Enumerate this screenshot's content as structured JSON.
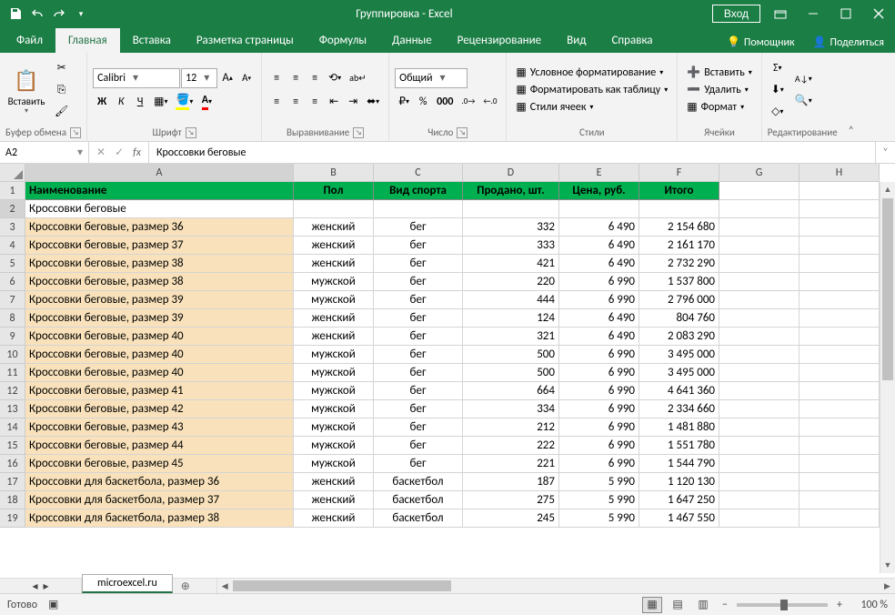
{
  "title": "Группировка - Excel",
  "login_btn": "Вход",
  "tabs": [
    "Файл",
    "Главная",
    "Вставка",
    "Разметка страницы",
    "Формулы",
    "Данные",
    "Рецензирование",
    "Вид",
    "Справка"
  ],
  "tab_active_idx": 1,
  "tell_me": "Помощник",
  "share": "Поделиться",
  "ribbon": {
    "clipboard": {
      "paste": "Вставить",
      "label": "Буфер обмена"
    },
    "font": {
      "name": "Calibri",
      "size": "12",
      "label": "Шрифт",
      "bold": "Ж",
      "italic": "К",
      "underline": "Ч"
    },
    "alignment": {
      "label": "Выравнивание"
    },
    "number": {
      "format": "Общий",
      "label": "Число"
    },
    "styles": {
      "cond": "Условное форматирование",
      "table": "Форматировать как таблицу",
      "cell": "Стили ячеек",
      "label": "Стили"
    },
    "cells": {
      "insert": "Вставить",
      "delete": "Удалить",
      "format": "Формат",
      "label": "Ячейки"
    },
    "editing": {
      "label": "Редактирование"
    }
  },
  "namebox": "A2",
  "formula": "Кроссовки беговые",
  "columns": [
    "A",
    "B",
    "C",
    "D",
    "E",
    "F",
    "G",
    "H"
  ],
  "headers": [
    "Наименование",
    "Пол",
    "Вид спорта",
    "Продано, шт.",
    "Цена, руб.",
    "Итого"
  ],
  "group_title": "Кроссовки беговые",
  "rows": [
    {
      "name": "Кроссовки беговые, размер 36",
      "gender": "женский",
      "sport": "бег",
      "sold": "332",
      "price": "6 490",
      "total": "2 154 680"
    },
    {
      "name": "Кроссовки беговые, размер 37",
      "gender": "женский",
      "sport": "бег",
      "sold": "333",
      "price": "6 490",
      "total": "2 161 170"
    },
    {
      "name": "Кроссовки беговые, размер 38",
      "gender": "женский",
      "sport": "бег",
      "sold": "421",
      "price": "6 490",
      "total": "2 732 290"
    },
    {
      "name": "Кроссовки беговые, размер 38",
      "gender": "мужской",
      "sport": "бег",
      "sold": "220",
      "price": "6 990",
      "total": "1 537 800"
    },
    {
      "name": "Кроссовки беговые, размер 39",
      "gender": "мужской",
      "sport": "бег",
      "sold": "444",
      "price": "6 990",
      "total": "2 796 000"
    },
    {
      "name": "Кроссовки беговые, размер 39",
      "gender": "женский",
      "sport": "бег",
      "sold": "124",
      "price": "6 490",
      "total": "804 760"
    },
    {
      "name": "Кроссовки беговые, размер 40",
      "gender": "женский",
      "sport": "бег",
      "sold": "321",
      "price": "6 490",
      "total": "2 083 290"
    },
    {
      "name": "Кроссовки беговые, размер 40",
      "gender": "мужской",
      "sport": "бег",
      "sold": "500",
      "price": "6 990",
      "total": "3 495 000"
    },
    {
      "name": "Кроссовки беговые, размер 40",
      "gender": "мужской",
      "sport": "бег",
      "sold": "500",
      "price": "6 990",
      "total": "3 495 000"
    },
    {
      "name": "Кроссовки беговые, размер 41",
      "gender": "мужской",
      "sport": "бег",
      "sold": "664",
      "price": "6 990",
      "total": "4 641 360"
    },
    {
      "name": "Кроссовки беговые, размер 42",
      "gender": "мужской",
      "sport": "бег",
      "sold": "334",
      "price": "6 990",
      "total": "2 334 660"
    },
    {
      "name": "Кроссовки беговые, размер 43",
      "gender": "мужской",
      "sport": "бег",
      "sold": "212",
      "price": "6 990",
      "total": "1 481 880"
    },
    {
      "name": "Кроссовки беговые, размер 44",
      "gender": "мужской",
      "sport": "бег",
      "sold": "222",
      "price": "6 990",
      "total": "1 551 780"
    },
    {
      "name": "Кроссовки беговые, размер 45",
      "gender": "мужской",
      "sport": "бег",
      "sold": "221",
      "price": "6 990",
      "total": "1 544 790"
    },
    {
      "name": "Кроссовки для баскетбола, размер 36",
      "gender": "женский",
      "sport": "баскетбол",
      "sold": "187",
      "price": "5 990",
      "total": "1 120 130"
    },
    {
      "name": "Кроссовки для баскетбола, размер 37",
      "gender": "женский",
      "sport": "баскетбол",
      "sold": "275",
      "price": "5 990",
      "total": "1 647 250"
    },
    {
      "name": "Кроссовки для баскетбола, размер 38",
      "gender": "женский",
      "sport": "баскетбол",
      "sold": "245",
      "price": "5 990",
      "total": "1 467 550"
    }
  ],
  "sheet_tab": "microexcel.ru",
  "status_ready": "Готово",
  "zoom": "100 %"
}
